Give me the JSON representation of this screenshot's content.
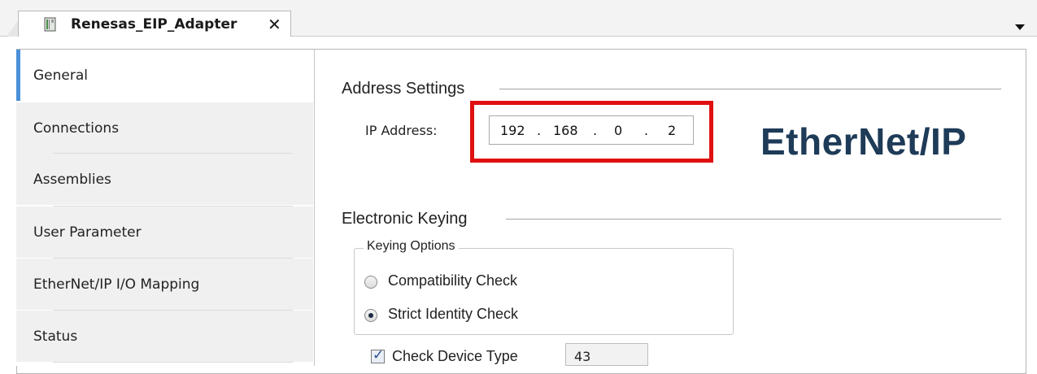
{
  "tab": {
    "title": "Renesas_EIP_Adapter",
    "close_glyph": "✕",
    "icon": "device-icon"
  },
  "sidebar": {
    "items": [
      {
        "label": "General",
        "active": true
      },
      {
        "label": "Connections",
        "active": false
      },
      {
        "label": "Assemblies",
        "active": false
      },
      {
        "label": "User Parameter",
        "active": false
      },
      {
        "label": "EtherNet/IP I/O Mapping",
        "active": false
      },
      {
        "label": "Status",
        "active": false
      }
    ]
  },
  "address_settings": {
    "title": "Address Settings",
    "ip_label": "IP Address:",
    "ip": [
      "192",
      "168",
      "0",
      "2"
    ]
  },
  "logo": {
    "text_a": "Ether",
    "text_b": "Net/IP"
  },
  "electronic_keying": {
    "title": "Electronic Keying",
    "group_title": "Keying Options",
    "options": [
      {
        "label": "Compatibility Check",
        "checked": false
      },
      {
        "label": "Strict Identity Check",
        "checked": true
      }
    ],
    "check_device_type": {
      "label": "Check Device Type",
      "checked": true,
      "value": "43"
    }
  },
  "colors": {
    "highlight": "#e01010",
    "logo": "#1e3b58",
    "active_bar": "#4a90d9"
  }
}
